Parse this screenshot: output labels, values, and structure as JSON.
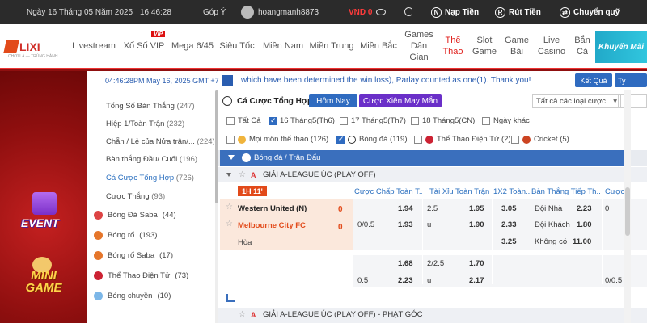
{
  "topbar": {
    "date": "Ngày 16 Tháng 05 Năm 2025",
    "time": "16:46:28",
    "feedback": "Góp Ý",
    "username": "hoangmanh8873",
    "balance": "VND 0",
    "deposit": "Nạp Tiền",
    "withdraw": "Rút Tiền",
    "transfer": "Chuyển quỹ"
  },
  "nav": {
    "logo": "LIXI",
    "logo_sub": "CHƠI LÀ — TRÚNG HÀNH",
    "vip_badge": "VIP",
    "items": [
      "Livestream",
      "Xổ Số VIP",
      "Mega 6/45",
      "Siêu Tốc",
      "Miền Nam",
      "Miền Trung",
      "Miền Bắc",
      "Games Dân Gian",
      "Thể Thao",
      "Slot Game",
      "Game Bài",
      "Live Casino",
      "Bắn Cá"
    ],
    "promo": "Khuyến Mãi"
  },
  "info": {
    "timestamp": "04:46:28PM May 16, 2025 GMT +7",
    "message": "which have been determined the win loss), Parlay counted as one(1). Thank you!",
    "result_btn": "Kết Quả",
    "extra_btn": "Ty"
  },
  "left_menu": {
    "sub_items": [
      {
        "label": "Tổng Số Bàn Thắng",
        "count": "(247)"
      },
      {
        "label": "Hiệp 1/Toàn Trận",
        "count": "(232)"
      },
      {
        "label": "Chẵn / Lẻ của Nửa trận/...",
        "count": "(224)"
      },
      {
        "label": "Bàn thắng Đầu/ Cuối",
        "count": "(196)"
      },
      {
        "label": "Cá Cược Tổng Hợp",
        "count": "(726)"
      },
      {
        "label": "Cược Thắng",
        "count": "(93)"
      }
    ],
    "sports": [
      {
        "label": "Bóng Đá Saba",
        "count": "(44)"
      },
      {
        "label": "Bóng rổ",
        "count": "(193)"
      },
      {
        "label": "Bóng rổ Saba",
        "count": "(17)"
      },
      {
        "label": "Thể Thao Điện Tử",
        "count": "(73)"
      },
      {
        "label": "Bóng chuyền",
        "count": "(10)"
      }
    ]
  },
  "banner": {
    "event": "EVENT",
    "minigame_1": "MINI",
    "minigame_2": "GAME"
  },
  "panel": {
    "title": "Cá Cược Tổng Hợp",
    "today_btn": "Hôm Nay",
    "parlay_btn": "Cược Xiên May Mắn",
    "bet_type_select": "Tất cả các loại cược",
    "date_filters": [
      {
        "label": "Tất Cả",
        "checked": false
      },
      {
        "label": "16 Tháng5(Th6)",
        "checked": true
      },
      {
        "label": "17 Tháng5(Th7)",
        "checked": false
      },
      {
        "label": "18 Tháng5(CN)",
        "checked": false
      },
      {
        "label": "Ngày khác",
        "checked": false
      }
    ],
    "sport_filters": [
      {
        "label": "Mọi môn thể thao (126)",
        "checked": false
      },
      {
        "label": "Bóng đá (119)",
        "checked": true
      },
      {
        "label": "Thể Thao Điện Tử (2)",
        "checked": false
      },
      {
        "label": "Cricket (5)",
        "checked": false
      }
    ],
    "sport_header": "Bóng đá / Trận Đấu",
    "league": "GIẢI A-LEAGUE ÚC (PLAY OFF)",
    "live_tag": "1H 11'",
    "columns": [
      "Cược Chấp Toàn T...",
      "Tài Xỉu Toàn Trận",
      "1X2 Toàn...",
      "Bàn Thắng Tiếp Th...",
      "Cược"
    ],
    "home_team": "Western United (N)",
    "away_team": "Melbourne City FC",
    "draw": "Hòa",
    "home_score": "0",
    "away_score": "0",
    "odds": {
      "hdp_r1": [
        "",
        "1.94"
      ],
      "hdp_r2": [
        "0/0.5",
        "1.93"
      ],
      "ou_r1": [
        "2.5",
        "1.95"
      ],
      "ou_r2": [
        "u",
        "1.90"
      ],
      "x12": [
        "3.05",
        "2.33",
        "3.25"
      ],
      "next_goal": [
        [
          "Đội Nhà",
          "2.23"
        ],
        [
          "Đội Khách",
          "1.80"
        ],
        [
          "Không có",
          "11.00"
        ]
      ],
      "extra": [
        "0"
      ],
      "alt_hdp": [
        [
          "",
          "1.68"
        ],
        [
          "0.5",
          "2.23"
        ]
      ],
      "alt_ou": [
        [
          "2/2.5",
          "1.70"
        ],
        [
          "u",
          "2.17"
        ]
      ],
      "alt_extra": "0/0.5"
    },
    "next_league": "GIẢI A-LEAGUE ÚC (PLAY OFF) - PHẠT GÓC"
  },
  "colors": {
    "accent_blue": "#2f6bc0",
    "parlay_purple": "#6a2fc8",
    "live_orange": "#e24a1a",
    "active_red": "#e0201d"
  }
}
